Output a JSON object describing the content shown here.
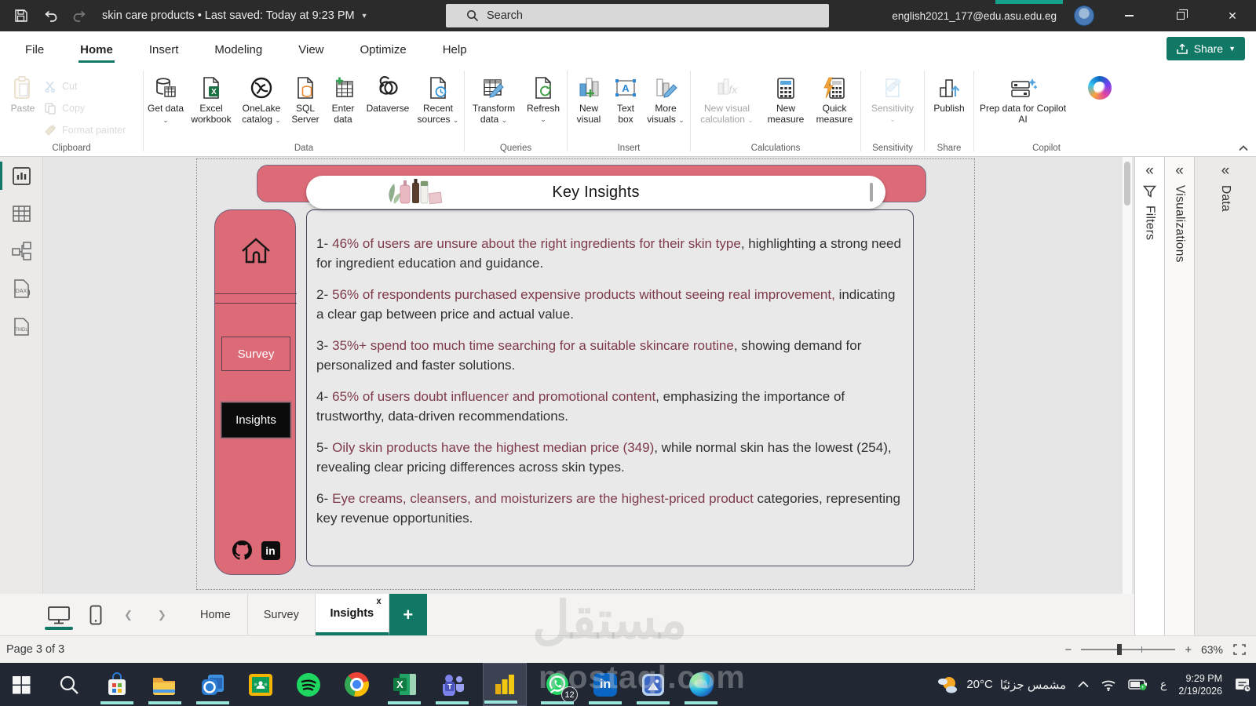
{
  "titlebar": {
    "title": "skin care products  •  Last saved: Today at 9:23 PM",
    "search_placeholder": "Search",
    "email": "english2021_177@edu.asu.edu.eg"
  },
  "menu": {
    "items": [
      "File",
      "Home",
      "Insert",
      "Modeling",
      "View",
      "Optimize",
      "Help"
    ],
    "share": "Share"
  },
  "ribbon": {
    "clipboard": {
      "group": "Clipboard",
      "paste": "Paste",
      "cut": "Cut",
      "copy": "Copy",
      "format_painter": "Format painter"
    },
    "data": {
      "group": "Data",
      "get_data": "Get data",
      "excel": "Excel workbook",
      "onelake": "OneLake catalog",
      "sql": "SQL Server",
      "enter": "Enter data",
      "dataverse": "Dataverse",
      "recent": "Recent sources"
    },
    "queries": {
      "group": "Queries",
      "transform": "Transform data",
      "refresh": "Refresh"
    },
    "insert": {
      "group": "Insert",
      "new_visual": "New visual",
      "text_box": "Text box",
      "more_visuals": "More visuals"
    },
    "calculations": {
      "group": "Calculations",
      "new_visual_calc": "New visual calculation",
      "new_measure": "New measure",
      "quick_measure": "Quick measure"
    },
    "sensitivity": {
      "group": "Sensitivity",
      "sensitivity": "Sensitivity"
    },
    "share": {
      "group": "Share",
      "publish": "Publish"
    },
    "copilot": {
      "group": "Copilot",
      "prep": "Prep data for Copilot AI"
    }
  },
  "left_rail": {
    "dax": "DAX",
    "tmdl": "TMDL"
  },
  "canvas": {
    "header_title": "Key Insights",
    "sidebar": {
      "survey": "Survey",
      "insights": "Insights"
    },
    "insights": [
      {
        "n": "1-",
        "hl": "46% of users are unsure about the right ingredients for their skin type",
        "rest": ", highlighting a strong need for ingredient education and guidance."
      },
      {
        "n": "2-",
        "hl": "56% of respondents purchased expensive products without seeing real improvement,",
        "rest": " indicating a clear gap between price and actual value."
      },
      {
        "n": "3-",
        "hl": "35%+ spend too much time searching for a suitable skincare routine",
        "rest": ", showing demand for personalized and faster solutions."
      },
      {
        "n": "4-",
        "hl": "65% of users doubt influencer and promotional content",
        "rest": ", emphasizing the importance of trustworthy, data-driven recommendations."
      },
      {
        "n": "5-",
        "hl": "Oily skin products have the highest median price (349)",
        "rest": ", while normal skin has the lowest (254), revealing clear pricing differences across skin types."
      },
      {
        "n": "6-",
        "hl": "Eye creams, cleansers, and moisturizers are the highest-priced product",
        "rest": " categories, representing key revenue opportunities."
      }
    ]
  },
  "panels": {
    "filters": "Filters",
    "visualizations": "Visualizations",
    "data": "Data"
  },
  "tabs": {
    "items": [
      "Home",
      "Survey",
      "Insights"
    ],
    "close": "x"
  },
  "status": {
    "page": "Page 3 of 3",
    "zoom": "63%"
  },
  "taskbar": {
    "whatsapp_badge": "12",
    "weather_temp": "20°C",
    "weather_condition": "مشمس جزئيًا",
    "lang": "ع",
    "time": "9:29 PM",
    "date": "2/19/2026"
  },
  "watermarks": {
    "center": "مستقل",
    "bottom": "mostaql.com"
  },
  "colors": {
    "accent": "#117865",
    "pink": "#dd6b77",
    "highlight_text": "#7e3a49",
    "taskbar": "#212733"
  }
}
